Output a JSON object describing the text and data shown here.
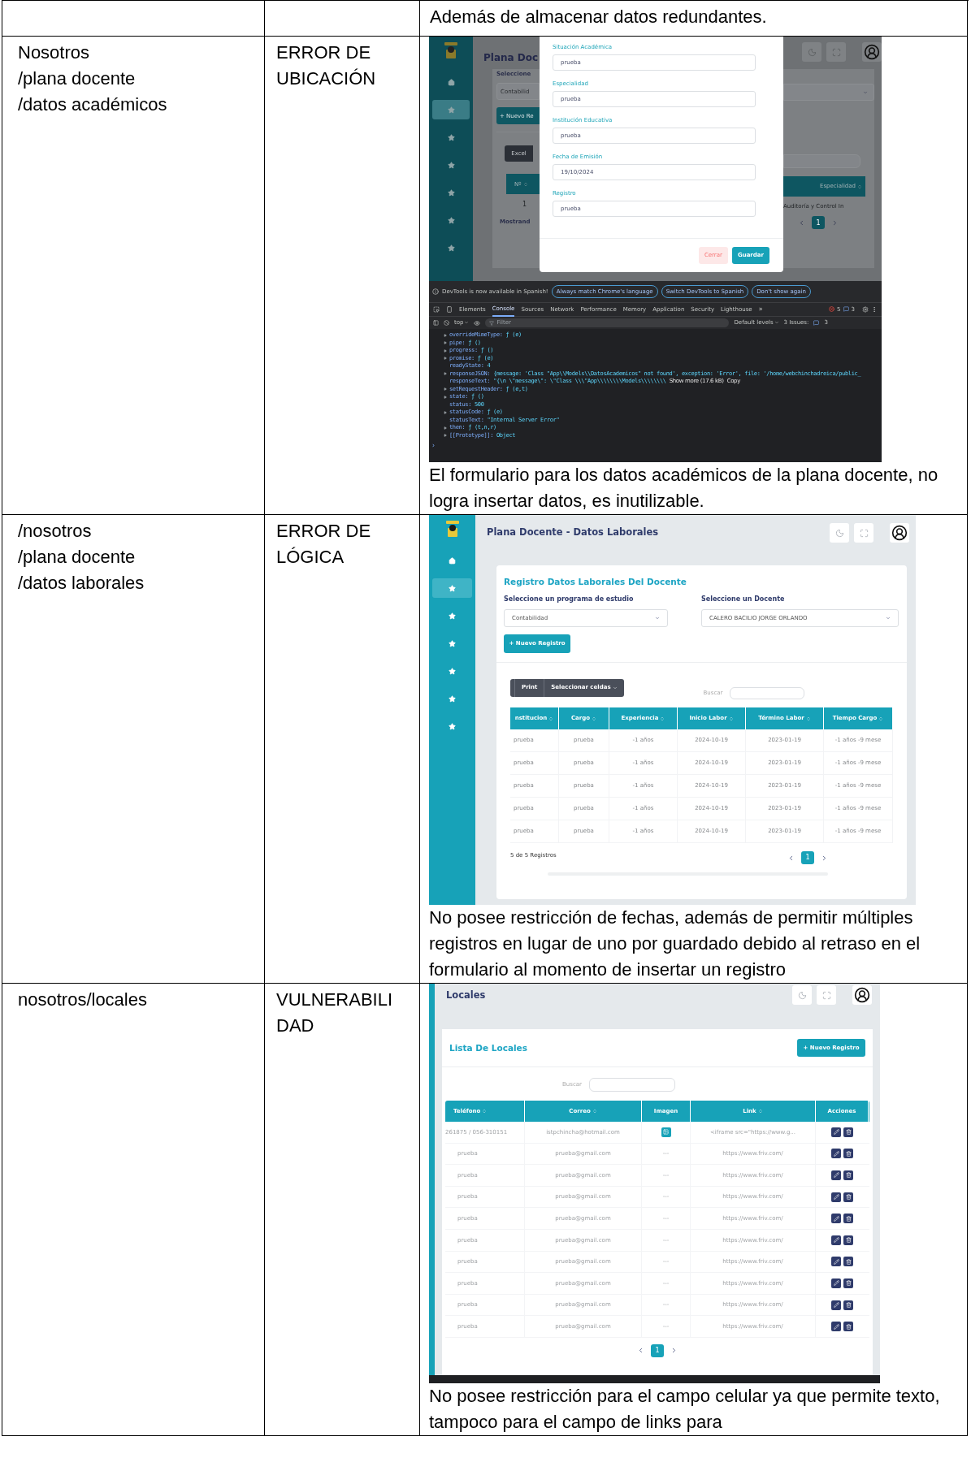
{
  "table": {
    "header_row": {
      "col_3": "Además de almacenar datos redundantes."
    },
    "rows": [
      {
        "route": [
          "Nosotros",
          "/plana docente",
          "/datos académicos"
        ],
        "category": "ERROR DE UBICACIÓN",
        "screenshot": {
          "kind": "modal_devtools",
          "app": {
            "title": "Plana Doc",
            "sidebar": [
              {
                "kind": "home",
                "selected": false
              },
              {
                "kind": "star",
                "selected": true
              },
              {
                "kind": "star",
                "selected": false
              },
              {
                "kind": "star",
                "selected": false
              },
              {
                "kind": "star",
                "selected": false
              },
              {
                "kind": "star",
                "selected": false
              },
              {
                "kind": "star",
                "selected": false
              }
            ],
            "left": {
              "heading": "Seleccione",
              "select": "Contabilid",
              "button": "+ Nuevo Re",
              "export_button": "Excel",
              "column": "Nº",
              "cell": "1",
              "footer": "Mostrand"
            },
            "right": {
              "column": "Especialidad",
              "cell": "Auditoría y Control In",
              "page": "1"
            },
            "modal": {
              "fields": [
                {
                  "label": "Situación Académica",
                  "value": "prueba"
                },
                {
                  "label": "Especialidad",
                  "value": "prueba"
                },
                {
                  "label": "Institución Educativa",
                  "value": "prueba"
                },
                {
                  "label": "Fecha de Emisión",
                  "value": "19/10/2024"
                },
                {
                  "label": "Registro",
                  "value": "prueba"
                }
              ],
              "buttons": [
                {
                  "label": "Cerrar",
                  "kind": "secondary"
                },
                {
                  "label": "Guardar",
                  "kind": "primary"
                }
              ]
            }
          },
          "devtools": {
            "banner": "DevTools is now available in Spanish!",
            "banner_buttons": [
              "Always match Chrome's language",
              "Switch DevTools to Spanish",
              "Don't show again"
            ],
            "tabs": [
              {
                "label": "Elements",
                "selected": false
              },
              {
                "label": "Console",
                "selected": true
              },
              {
                "label": "Sources",
                "selected": false
              },
              {
                "label": "Network",
                "selected": false
              },
              {
                "label": "Performance",
                "selected": false
              },
              {
                "label": "Memory",
                "selected": false
              },
              {
                "label": "Application",
                "selected": false
              },
              {
                "label": "Security",
                "selected": false
              },
              {
                "label": "Lighthouse",
                "selected": false
              }
            ],
            "more": "»",
            "errors": "5",
            "messages": "3",
            "context": "top",
            "filter_placeholder": "Filter",
            "levels": "Default levels",
            "issues_label": "3 Issues:",
            "issues": "3",
            "lines": [
              {
                "key": "overrideMimeType:",
                "value": "ƒ (e)",
                "expandable": true
              },
              {
                "key": "pipe:",
                "value": "ƒ ()",
                "expandable": true
              },
              {
                "key": "progress:",
                "value": "ƒ ()",
                "expandable": true
              },
              {
                "key": "promise:",
                "value": "ƒ (e)",
                "expandable": true
              },
              {
                "key": "readyState:",
                "value": "4",
                "expandable": false
              },
              {
                "key": "responseJSON:",
                "value": "{message: 'Class \"App\\\\Models\\\\DatosAcademicos\" not found', exception: 'Error', file: '/home/webchinchadreica/public_",
                "expandable": true
              },
              {
                "key": "responseText:",
                "value": "\"{\\n    \\\"message\\\": \\\"Class \\\\\\\"App\\\\\\\\\\\\\\\\Models\\\\\\\\\\\\\\\\",
                "expandable": false,
                "extras": [
                  "Show more (17.6 kB)",
                  "Copy"
                ]
              },
              {
                "key": "setRequestHeader:",
                "value": "ƒ (e,t)",
                "expandable": true
              },
              {
                "key": "state:",
                "value": "ƒ ()",
                "expandable": true
              },
              {
                "key": "status:",
                "value": "500",
                "expandable": false
              },
              {
                "key": "statusCode:",
                "value": "ƒ (e)",
                "expandable": true
              },
              {
                "key": "statusText:",
                "value": "\"Internal Server Error\"",
                "expandable": false
              },
              {
                "key": "then:",
                "value": "ƒ (t,n,r)",
                "expandable": true
              },
              {
                "key": "[[Prototype]]:",
                "value": "Object",
                "expandable": true
              }
            ],
            "prompt": "›"
          }
        },
        "caption": "El formulario para los datos académicos de la plana docente, no logra insertar datos, es inutilizable."
      },
      {
        "route": [
          "/nosotros",
          "/plana docente",
          "/datos laborales"
        ],
        "category": "ERROR DE LÓGICA",
        "screenshot": {
          "kind": "table_page",
          "title": "Plana Docente - Datos Laborales",
          "sidebar": [
            {
              "kind": "home",
              "selected": false
            },
            {
              "kind": "star",
              "selected": true
            },
            {
              "kind": "star",
              "selected": false
            },
            {
              "kind": "star",
              "selected": false
            },
            {
              "kind": "star",
              "selected": false
            },
            {
              "kind": "star",
              "selected": false
            },
            {
              "kind": "star",
              "selected": false
            }
          ],
          "card_title": "Registro Datos Laborales Del Docente",
          "selects": [
            {
              "label": "Seleccione un programa de estudio",
              "value": "Contabilidad"
            },
            {
              "label": "Seleccione un Docente",
              "value": "CALERO BACILIO JORGE ORLANDO"
            }
          ],
          "button": "+ Nuevo Registro",
          "toolbar": [
            "Print",
            "Seleccionar celdas"
          ],
          "search_label": "Buscar",
          "columns": [
            "nstitucion",
            "Cargo",
            "Experiencia",
            "Inicio Labor",
            "Término Labor",
            "Tiempo Cargo"
          ],
          "rows": [
            [
              "prueba",
              "prueba",
              "-1 años",
              "2024-10-19",
              "2023-01-19",
              "-1 años -9 mese"
            ],
            [
              "prueba",
              "prueba",
              "-1 años",
              "2024-10-19",
              "2023-01-19",
              "-1 años -9 mese"
            ],
            [
              "prueba",
              "prueba",
              "-1 años",
              "2024-10-19",
              "2023-01-19",
              "-1 años -9 mese"
            ],
            [
              "prueba",
              "prueba",
              "-1 años",
              "2024-10-19",
              "2023-01-19",
              "-1 años -9 mese"
            ],
            [
              "prueba",
              "prueba",
              "-1 años",
              "2024-10-19",
              "2023-01-19",
              "-1 años -9 mese"
            ]
          ],
          "footer": "5 de 5 Registros",
          "page": "1"
        },
        "caption": "No posee restricción de fechas, además de permitir múltiples registros en lugar de uno por guardado debido al retraso en el formulario al momento de insertar un registro"
      },
      {
        "route": [
          "nosotros/locales"
        ],
        "category": "VULNERABILIDAD",
        "screenshot": {
          "kind": "list_page",
          "title": "Locales",
          "card_title": "Lista De Locales",
          "button": "+ Nuevo Registro",
          "search_label": "Buscar",
          "columns": [
            {
              "label": "Teléfono",
              "sortable": true
            },
            {
              "label": "Correo",
              "sortable": true
            },
            {
              "label": "Imagen",
              "sortable": false
            },
            {
              "label": "Link",
              "sortable": true
            },
            {
              "label": "Acciones",
              "sortable": false
            }
          ],
          "rows": [
            {
              "phone": "261875 / 056-310151",
              "email": "istpchincha@hotmail.com",
              "image": {
                "kind": "icon"
              },
              "link": "<iframe src=\"https://www.g..."
            },
            {
              "phone": "prueba",
              "email": "prueba@gmail.com",
              "image": {
                "kind": "text",
                "text": "---"
              },
              "link": "https://www.friv.com/"
            },
            {
              "phone": "prueba",
              "email": "prueba@gmail.com",
              "image": {
                "kind": "text",
                "text": "---"
              },
              "link": "https://www.friv.com/"
            },
            {
              "phone": "prueba",
              "email": "prueba@gmail.com",
              "image": {
                "kind": "text",
                "text": "---"
              },
              "link": "https://www.friv.com/"
            },
            {
              "phone": "prueba",
              "email": "prueba@gmail.com",
              "image": {
                "kind": "text",
                "text": "---"
              },
              "link": "https://www.friv.com/"
            },
            {
              "phone": "prueba",
              "email": "prueba@gmail.com",
              "image": {
                "kind": "text",
                "text": "---"
              },
              "link": "https://www.friv.com/"
            },
            {
              "phone": "prueba",
              "email": "prueba@gmail.com",
              "image": {
                "kind": "text",
                "text": "---"
              },
              "link": "https://www.friv.com/"
            },
            {
              "phone": "prueba",
              "email": "prueba@gmail.com",
              "image": {
                "kind": "text",
                "text": "---"
              },
              "link": "https://www.friv.com/"
            },
            {
              "phone": "prueba",
              "email": "prueba@gmail.com",
              "image": {
                "kind": "text",
                "text": "---"
              },
              "link": "https://www.friv.com/"
            },
            {
              "phone": "prueba",
              "email": "prueba@gmail.com",
              "image": {
                "kind": "text",
                "text": "---"
              },
              "link": "https://www.friv.com/"
            }
          ],
          "page": "1"
        },
        "caption": "No posee restricción para el campo celular ya que permite texto, tampoco para el campo de links para"
      }
    ]
  }
}
